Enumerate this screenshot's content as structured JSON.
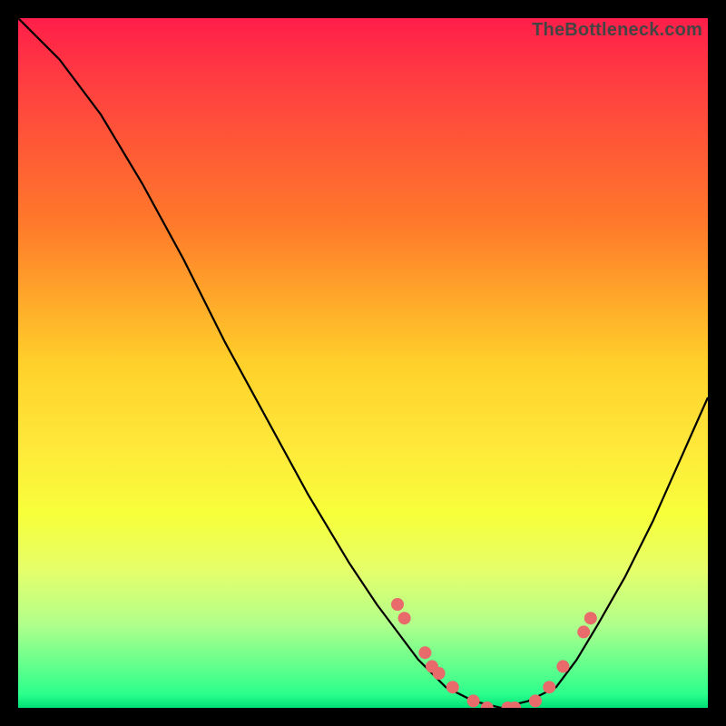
{
  "attribution": "TheBottleneck.com",
  "gradient_colors": {
    "top": "#ff1e4a",
    "upper_mid": "#ffd02a",
    "lower_mid": "#f7ff3a",
    "bottom": "#00e077"
  },
  "curve_style": {
    "stroke": "#000000",
    "stroke_width": 2.2
  },
  "dot_style": {
    "fill": "#e86a6a",
    "radius": 7
  },
  "chart_data": {
    "type": "line",
    "title": "",
    "xlabel": "",
    "ylabel": "",
    "xlim": [
      0,
      100
    ],
    "ylim": [
      0,
      100
    ],
    "grid": false,
    "legend": false,
    "series": [
      {
        "name": "curve",
        "x": [
          0,
          6,
          12,
          18,
          24,
          30,
          36,
          42,
          48,
          52,
          55,
          58,
          62,
          66,
          70,
          74,
          78,
          81,
          84,
          88,
          92,
          96,
          100
        ],
        "y": [
          100,
          94,
          86,
          76,
          65,
          53,
          42,
          31,
          21,
          15,
          11,
          7,
          3,
          1,
          0,
          1,
          3,
          7,
          12,
          19,
          27,
          36,
          45
        ]
      }
    ],
    "dots": {
      "name": "markers",
      "x": [
        55,
        56,
        59,
        60,
        61,
        63,
        66,
        68,
        71,
        72,
        75,
        77,
        79,
        82,
        83
      ],
      "y": [
        15,
        13,
        8,
        6,
        5,
        3,
        1,
        0,
        0,
        0,
        1,
        3,
        6,
        11,
        13
      ]
    }
  }
}
